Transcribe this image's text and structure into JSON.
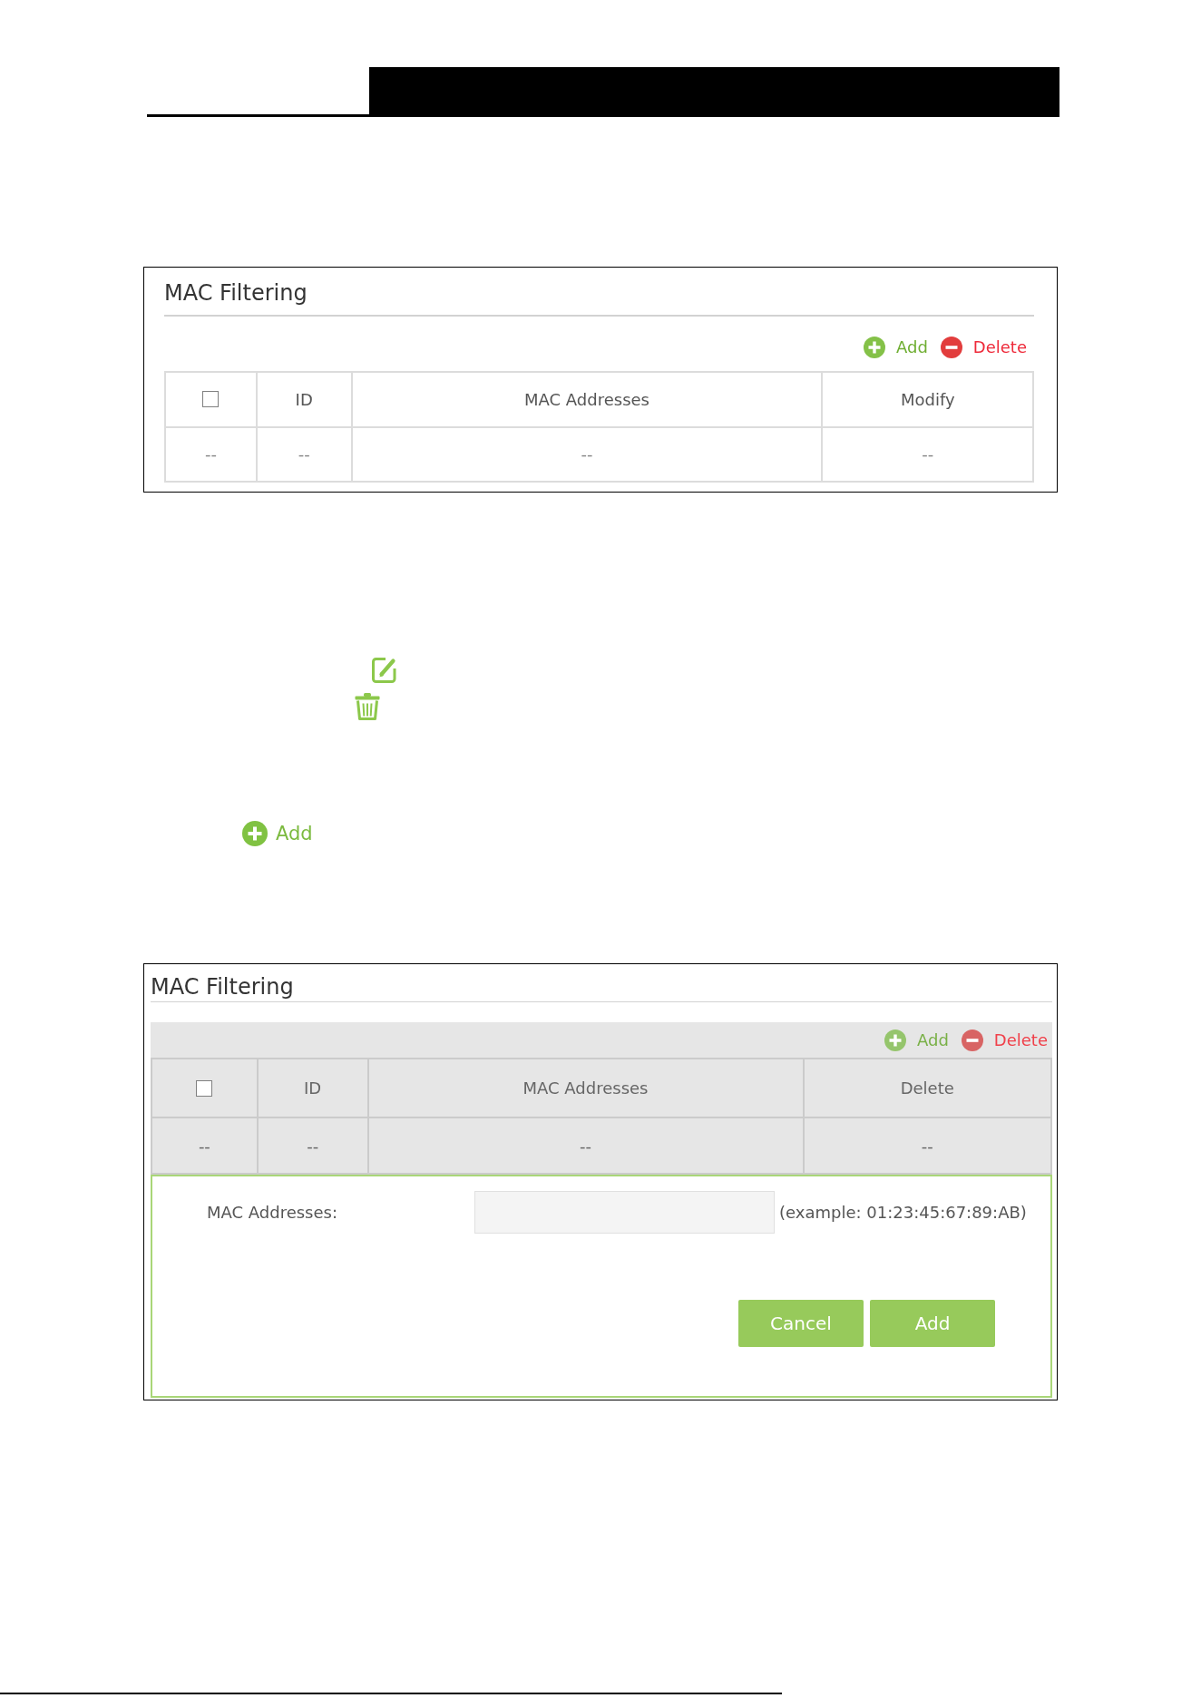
{
  "figure_1": {
    "title": "MAC Filtering",
    "dimmed": false,
    "toolbar": [
      {
        "kind": "add",
        "label": "Add"
      },
      {
        "kind": "delete",
        "label": "Delete"
      }
    ],
    "table": {
      "columns": [
        {
          "kind": "checkbox",
          "checked": false
        },
        {
          "kind": "text",
          "label": "ID"
        },
        {
          "kind": "text",
          "label": "MAC Addresses"
        },
        {
          "kind": "text",
          "label": "Modify"
        }
      ],
      "rows": [
        [
          "--",
          "--",
          "--",
          "--"
        ]
      ]
    }
  },
  "inline_add": {
    "label": "Add"
  },
  "figure_2": {
    "title": "MAC Filtering",
    "dimmed": true,
    "toolbar": [
      {
        "kind": "add",
        "label": "Add"
      },
      {
        "kind": "delete",
        "label": "Delete"
      }
    ],
    "table": {
      "columns": [
        {
          "kind": "checkbox",
          "checked": false
        },
        {
          "kind": "text",
          "label": "ID"
        },
        {
          "kind": "text",
          "label": "MAC Addresses"
        },
        {
          "kind": "text",
          "label": "Delete"
        }
      ],
      "rows": [
        [
          "--",
          "--",
          "--",
          "--"
        ]
      ]
    },
    "form": {
      "fields": [
        {
          "label": "MAC Addresses:",
          "hint": "(example: 01:23:45:67:89:AB)"
        }
      ],
      "buttons": [
        "Cancel",
        "Add"
      ]
    }
  }
}
